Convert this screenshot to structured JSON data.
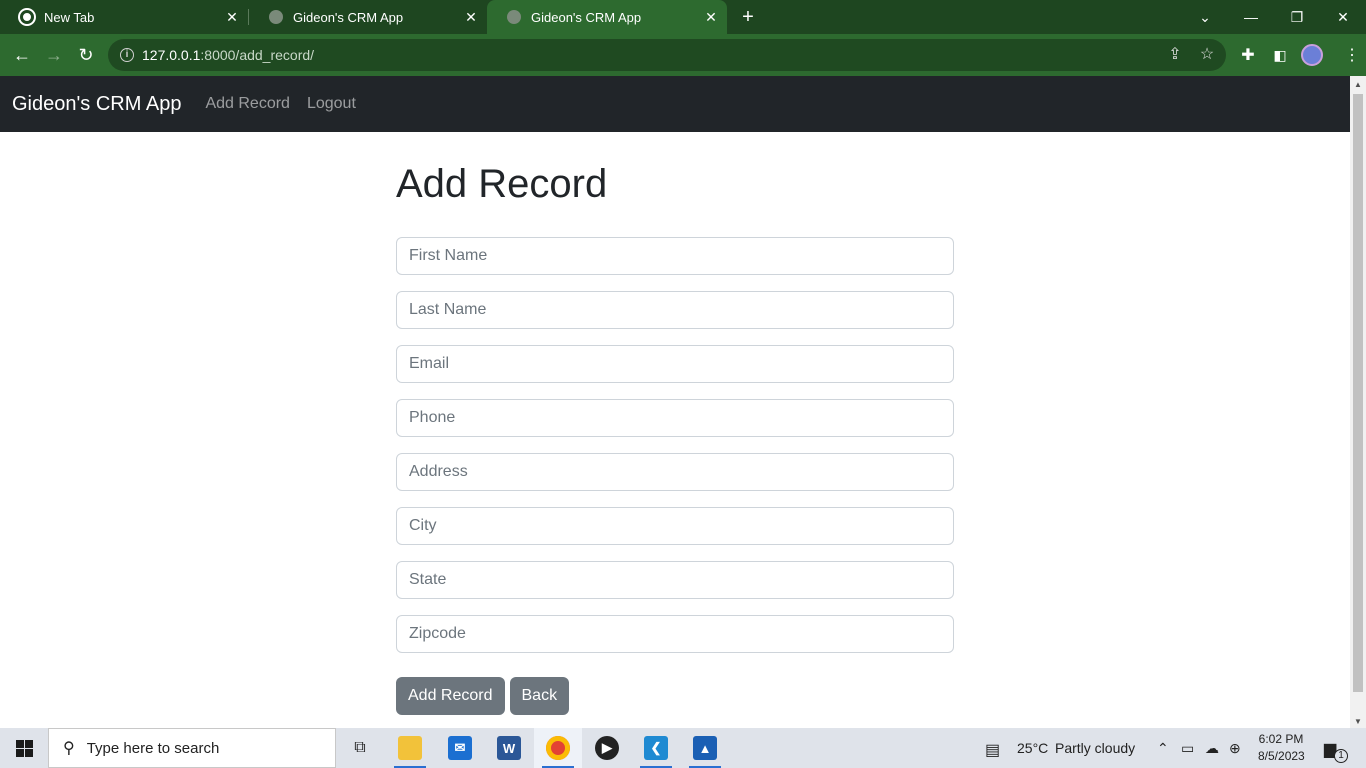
{
  "browser": {
    "tabs": [
      {
        "title": "New Tab",
        "active": false
      },
      {
        "title": "Gideon's CRM App",
        "active": false
      },
      {
        "title": "Gideon's CRM App",
        "active": true
      }
    ],
    "url_host": "127.0.0.1",
    "url_rest": ":8000/add_record/"
  },
  "navbar": {
    "brand": "Gideon's CRM App",
    "links": [
      "Add Record",
      "Logout"
    ]
  },
  "page": {
    "title": "Add Record",
    "fields": [
      {
        "placeholder": "First Name",
        "value": ""
      },
      {
        "placeholder": "Last Name",
        "value": ""
      },
      {
        "placeholder": "Email",
        "value": ""
      },
      {
        "placeholder": "Phone",
        "value": ""
      },
      {
        "placeholder": "Address",
        "value": ""
      },
      {
        "placeholder": "City",
        "value": ""
      },
      {
        "placeholder": "State",
        "value": ""
      },
      {
        "placeholder": "Zipcode",
        "value": ""
      }
    ],
    "buttons": {
      "submit": "Add Record",
      "back": "Back"
    }
  },
  "taskbar": {
    "search_placeholder": "Type here to search",
    "weather_temp": "25°C",
    "weather_desc": "Partly cloudy",
    "time": "6:02 PM",
    "date": "8/5/2023",
    "notification_count": "1"
  },
  "colors": {
    "browser_frame": "#1e4620",
    "browser_toolbar": "#2d6a2f",
    "navbar": "#212529",
    "button": "#6c757d"
  }
}
